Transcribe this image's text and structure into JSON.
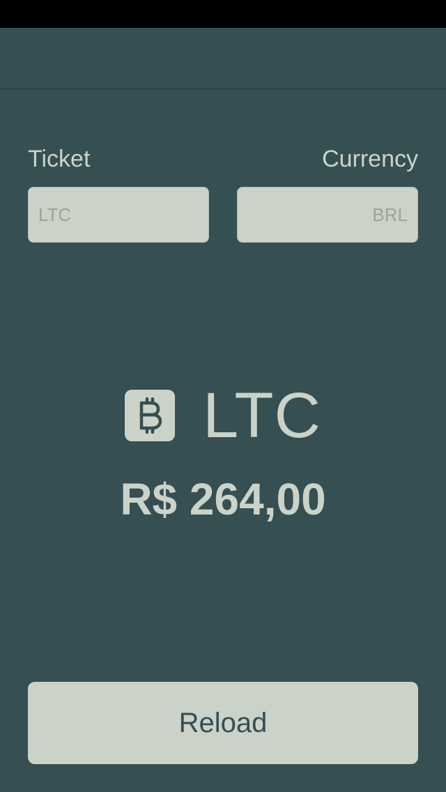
{
  "colors": {
    "background": "#354f53",
    "foreground": "#cbd3c8",
    "field_placeholder": "#9aa29c",
    "status_bar": "#000000"
  },
  "form": {
    "ticket_label": "Ticket",
    "currency_label": "Currency",
    "ticket_placeholder": "LTC",
    "currency_placeholder": "BRL"
  },
  "quote": {
    "icon": "bitcoin-icon",
    "symbol": "LTC",
    "price": "R$ 264,00"
  },
  "actions": {
    "reload_label": "Reload"
  }
}
